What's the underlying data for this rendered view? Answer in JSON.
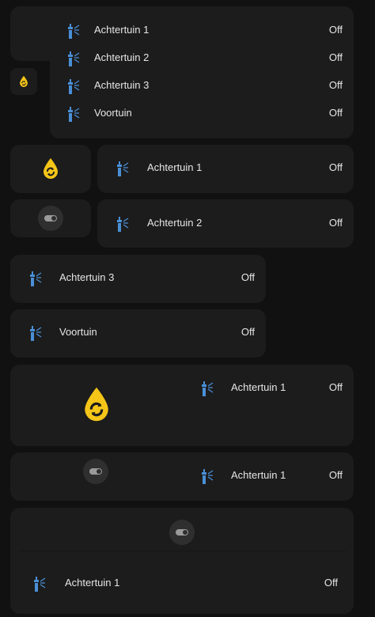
{
  "colors": {
    "background": "#111111",
    "card": "#1c1c1c",
    "accent": "#f5c518",
    "sprinkler": "#4a8fd6",
    "text": "#e6e6e6"
  },
  "icons": {
    "sprinkler": "sprinkler-icon",
    "water_sync": "water-sync-icon",
    "toggle": "toggle-switch-icon"
  },
  "group1": {
    "rows": [
      {
        "name": "Achtertuin 1",
        "state": "Off"
      },
      {
        "name": "Achtertuin 2",
        "state": "Off"
      },
      {
        "name": "Achtertuin 3",
        "state": "Off"
      },
      {
        "name": "Voortuin",
        "state": "Off"
      }
    ]
  },
  "group2": {
    "right_rows": [
      {
        "name": "Achtertuin 1",
        "state": "Off"
      },
      {
        "name": "Achtertuin 2",
        "state": "Off"
      }
    ],
    "full_rows": [
      {
        "name": "Achtertuin 3",
        "state": "Off"
      },
      {
        "name": "Voortuin",
        "state": "Off"
      }
    ]
  },
  "group3": {
    "row": {
      "name": "Achtertuin 1",
      "state": "Off"
    }
  },
  "group4": {
    "row": {
      "name": "Achtertuin 1",
      "state": "Off"
    }
  },
  "group5": {
    "row": {
      "name": "Achtertuin 1",
      "state": "Off"
    }
  }
}
